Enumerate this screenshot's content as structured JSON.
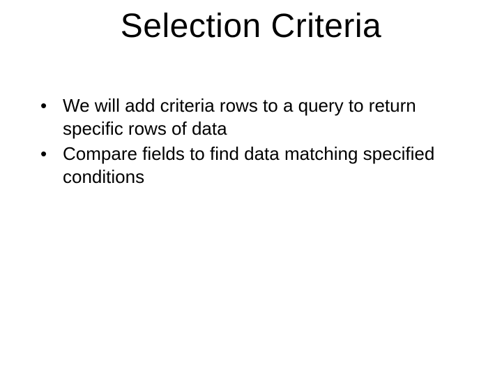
{
  "slide": {
    "title": "Selection Criteria",
    "bullets": [
      "We will add criteria rows to a query to return specific rows of data",
      "Compare fields to find data matching specified conditions"
    ]
  }
}
